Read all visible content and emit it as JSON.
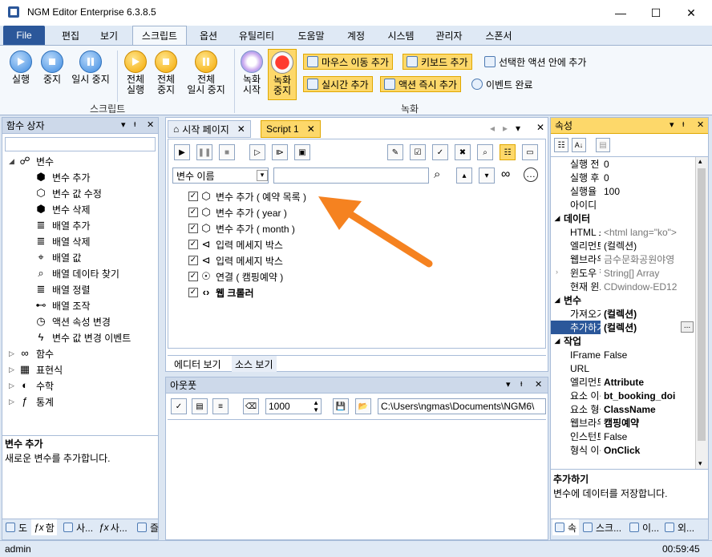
{
  "window": {
    "title": "NGM Editor   Enterprise 6.3.8.5",
    "minimize": "—",
    "maximize": "☐",
    "close": "✕"
  },
  "ribbon_tabs": [
    "File",
    "편집",
    "보기",
    "스크립트",
    "옵션",
    "유틸리티",
    "도움말",
    "계정",
    "시스템",
    "관리자",
    "스폰서"
  ],
  "ribbon": {
    "run": "실행",
    "stop": "중지",
    "pause": "일시 중지",
    "run_all_1": "전체",
    "run_all_2": "실행",
    "stop_all_1": "전체",
    "stop_all_2": "중지",
    "pause_all_1": "전체",
    "pause_all_2": "일시 중지",
    "script_group": "스크립트",
    "rec_start_1": "녹화",
    "rec_start_2": "시작",
    "rec_stop_1": "녹화",
    "rec_stop_2": "중지",
    "mouse_add": "마우스 이동 추가",
    "key_add": "키보드 추가",
    "in_action": "선택한 액션 안에 추가",
    "realtime_add": "실시간 추가",
    "action_instant": "액션 즉시 추가",
    "event_done": "이벤트 완료",
    "rec_group": "녹화"
  },
  "left_panel": {
    "title": "함수 상자",
    "tree": {
      "variables": "변수",
      "children": [
        "변수 추가",
        "변수 값 수정",
        "변수 삭제",
        "배열 추가",
        "배열 삭제",
        "배열 값",
        "배열 데이타 찾기",
        "배열 정렬",
        "배열 조작",
        "액션 속성 변경",
        "변수 값 변경 이벤트"
      ],
      "others": [
        "함수",
        "표현식",
        "수학",
        "통계"
      ]
    },
    "desc_title": "변수 추가",
    "desc_text": "새로운 변수를 추가합니다.",
    "bottom_tabs": [
      "도",
      "함",
      "사...",
      "사...",
      "즐"
    ]
  },
  "editor": {
    "tab_start": "시작 페이지",
    "tab_script": "Script 1",
    "search_select": "변수 이름",
    "lines": [
      {
        "text": "변수 추가 ( 예약 목록 )",
        "bold": false
      },
      {
        "text": "변수 추가 ( year )",
        "bold": false
      },
      {
        "text": "변수 추가 ( month )",
        "bold": false
      },
      {
        "text": "입력 메세지 박스",
        "bold": false
      },
      {
        "text": "입력 메세지 박스",
        "bold": false
      },
      {
        "text": "연결 ( 캠핑예약 )",
        "bold": false
      },
      {
        "text": "웹 크롤러",
        "bold": true
      }
    ],
    "bottom_tabs": [
      "에디터 보기",
      "소스 보기"
    ]
  },
  "output": {
    "title": "아웃풋",
    "count": "1000",
    "path": "C:\\Users\\ngmas\\Documents\\NGM6\\"
  },
  "properties": {
    "title": "속성",
    "rows_top": [
      {
        "name": "실행 전 지",
        "value": "0"
      },
      {
        "name": "실행 후 지",
        "value": "0"
      },
      {
        "name": "실행율",
        "value": "100"
      },
      {
        "name": "아이디",
        "value": ""
      }
    ],
    "cat_data": "데이터",
    "rows_data": [
      {
        "name": "HTML 소스",
        "value": "<html lang=\"ko\">",
        "grey": true
      },
      {
        "name": "엘리먼트 !",
        "value": "(컬렉션)",
        "grey": false
      },
      {
        "name": "웹브라우저",
        "value": "금수문화공원야영",
        "grey": true
      },
      {
        "name": "윈도우 핸",
        "value": "String[] Array",
        "grey": true
      },
      {
        "name": "현재 윈도",
        "value": "CDwindow-ED12",
        "grey": true
      }
    ],
    "cat_var": "변수",
    "rows_var": [
      {
        "name": "가져오기",
        "value": "(컬렉션)"
      },
      {
        "name": "추가하기",
        "value": "(컬렉션)"
      }
    ],
    "cat_work": "작업",
    "rows_work": [
      {
        "name": "IFrame 사",
        "value": "False",
        "bold": false
      },
      {
        "name": "URL",
        "value": "",
        "bold": false
      },
      {
        "name": "엘리먼트 ;",
        "value": "Attribute",
        "bold": true
      },
      {
        "name": "요소 이름",
        "value": "bt_booking_doi",
        "bold": true
      },
      {
        "name": "요소 형식",
        "value": "ClassName",
        "bold": true
      },
      {
        "name": "웹브라우저",
        "value": "캠핑예약",
        "bold": true
      },
      {
        "name": "인스턴트 !",
        "value": "False",
        "bold": false
      },
      {
        "name": "형식 이름",
        "value": "OnClick",
        "bold": true
      }
    ],
    "ellipsis": "...",
    "desc_title": "추가하기",
    "desc_text": "변수에 데이터를 저장합니다.",
    "bottom_tabs": [
      "속",
      "스크...",
      "이...",
      "외..."
    ]
  },
  "status": {
    "user": "admin",
    "time": "00:59:45"
  },
  "colors": {
    "accent": "#2b579a",
    "arrow": "#f58220",
    "highlight": "#fdd86a"
  }
}
